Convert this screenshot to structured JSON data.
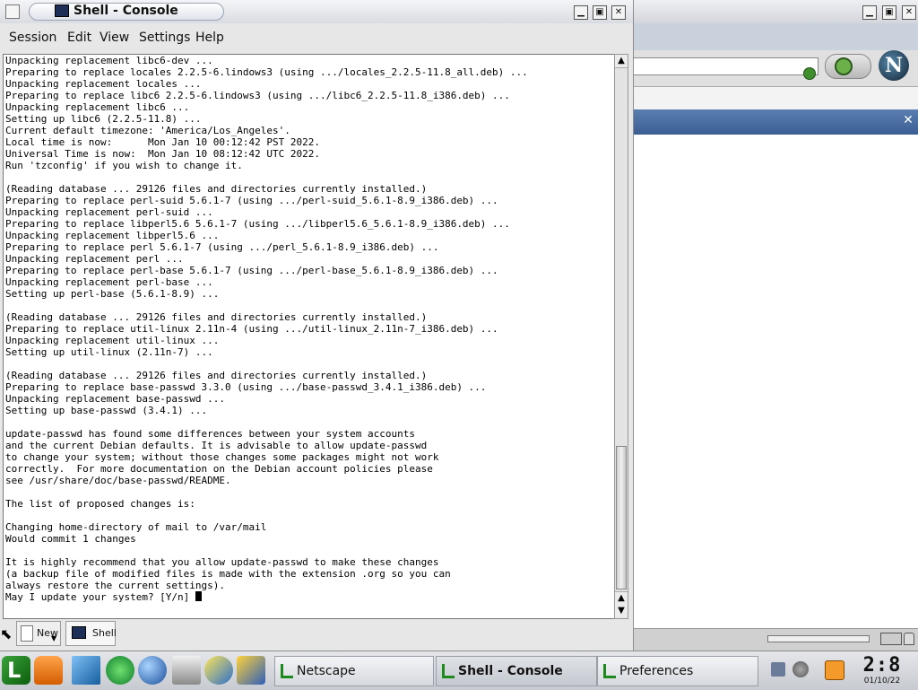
{
  "console": {
    "title": "Shell - Console",
    "menu": [
      "Session",
      "Edit",
      "View",
      "Settings",
      "Help"
    ],
    "terminal_lines": [
      "Unpacking replacement libc6-dev ...",
      "Preparing to replace locales 2.2.5-6.lindows3 (using .../locales_2.2.5-11.8_all.deb) ...",
      "Unpacking replacement locales ...",
      "Preparing to replace libc6 2.2.5-6.lindows3 (using .../libc6_2.2.5-11.8_i386.deb) ...",
      "Unpacking replacement libc6 ...",
      "Setting up libc6 (2.2.5-11.8) ...",
      "Current default timezone: 'America/Los_Angeles'.",
      "Local time is now:      Mon Jan 10 00:12:42 PST 2022.",
      "Universal Time is now:  Mon Jan 10 08:12:42 UTC 2022.",
      "Run 'tzconfig' if you wish to change it.",
      "",
      "(Reading database ... 29126 files and directories currently installed.)",
      "Preparing to replace perl-suid 5.6.1-7 (using .../perl-suid_5.6.1-8.9_i386.deb) ...",
      "Unpacking replacement perl-suid ...",
      "Preparing to replace libperl5.6 5.6.1-7 (using .../libperl5.6_5.6.1-8.9_i386.deb) ...",
      "Unpacking replacement libperl5.6 ...",
      "Preparing to replace perl 5.6.1-7 (using .../perl_5.6.1-8.9_i386.deb) ...",
      "Unpacking replacement perl ...",
      "Preparing to replace perl-base 5.6.1-7 (using .../perl-base_5.6.1-8.9_i386.deb) ...",
      "Unpacking replacement perl-base ...",
      "Setting up perl-base (5.6.1-8.9) ...",
      "",
      "(Reading database ... 29126 files and directories currently installed.)",
      "Preparing to replace util-linux 2.11n-4 (using .../util-linux_2.11n-7_i386.deb) ...",
      "Unpacking replacement util-linux ...",
      "Setting up util-linux (2.11n-7) ...",
      "",
      "(Reading database ... 29126 files and directories currently installed.)",
      "Preparing to replace base-passwd 3.3.0 (using .../base-passwd_3.4.1_i386.deb) ...",
      "Unpacking replacement base-passwd ...",
      "Setting up base-passwd (3.4.1) ...",
      "",
      "update-passwd has found some differences between your system accounts",
      "and the current Debian defaults. It is advisable to allow update-passwd",
      "to change your system; without those changes some packages might not work",
      "correctly.  For more documentation on the Debian account policies please",
      "see /usr/share/doc/base-passwd/README.",
      "",
      "The list of proposed changes is:",
      "",
      "Changing home-directory of mail to /var/mail",
      "Would commit 1 changes",
      "",
      "It is highly recommend that you allow update-passwd to make these changes",
      "(a backup file of modified files is made with the extension .org so you can",
      "always restore the current settings).",
      ""
    ],
    "prompt": "May I update your system? [Y/n] ",
    "tabs": {
      "new": "New",
      "shell": "Shell"
    }
  },
  "netscape": {
    "logo_letter": "N"
  },
  "taskbar": {
    "tasks": [
      "Netscape",
      "Shell - Console",
      "Preferences"
    ],
    "clock_time": "2:8",
    "clock_date": "01/10/22"
  }
}
